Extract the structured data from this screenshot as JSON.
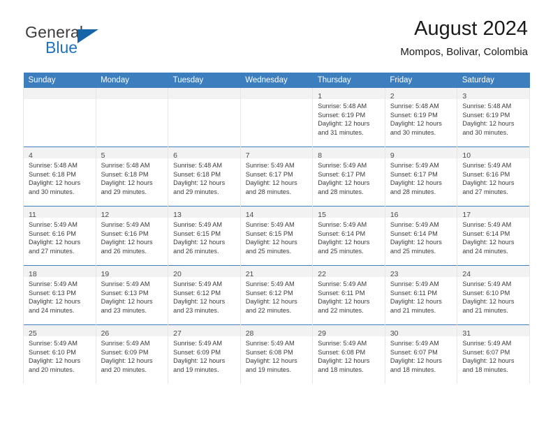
{
  "brand": {
    "name_part1": "General",
    "name_part2": "Blue"
  },
  "header": {
    "title": "August 2024",
    "subtitle": "Mompos, Bolivar, Colombia"
  },
  "colors": {
    "header_blue": "#3d7ebe",
    "logo_blue": "#1e73be",
    "daynum_band": "#f2f2f2",
    "cell_border": "#e6e6e6"
  },
  "weekdays": [
    "Sunday",
    "Monday",
    "Tuesday",
    "Wednesday",
    "Thursday",
    "Friday",
    "Saturday"
  ],
  "weeks": [
    [
      {
        "day": "",
        "lines": []
      },
      {
        "day": "",
        "lines": []
      },
      {
        "day": "",
        "lines": []
      },
      {
        "day": "",
        "lines": []
      },
      {
        "day": "1",
        "lines": [
          "Sunrise: 5:48 AM",
          "Sunset: 6:19 PM",
          "Daylight: 12 hours",
          "and 31 minutes."
        ]
      },
      {
        "day": "2",
        "lines": [
          "Sunrise: 5:48 AM",
          "Sunset: 6:19 PM",
          "Daylight: 12 hours",
          "and 30 minutes."
        ]
      },
      {
        "day": "3",
        "lines": [
          "Sunrise: 5:48 AM",
          "Sunset: 6:19 PM",
          "Daylight: 12 hours",
          "and 30 minutes."
        ]
      }
    ],
    [
      {
        "day": "4",
        "lines": [
          "Sunrise: 5:48 AM",
          "Sunset: 6:18 PM",
          "Daylight: 12 hours",
          "and 30 minutes."
        ]
      },
      {
        "day": "5",
        "lines": [
          "Sunrise: 5:48 AM",
          "Sunset: 6:18 PM",
          "Daylight: 12 hours",
          "and 29 minutes."
        ]
      },
      {
        "day": "6",
        "lines": [
          "Sunrise: 5:48 AM",
          "Sunset: 6:18 PM",
          "Daylight: 12 hours",
          "and 29 minutes."
        ]
      },
      {
        "day": "7",
        "lines": [
          "Sunrise: 5:49 AM",
          "Sunset: 6:17 PM",
          "Daylight: 12 hours",
          "and 28 minutes."
        ]
      },
      {
        "day": "8",
        "lines": [
          "Sunrise: 5:49 AM",
          "Sunset: 6:17 PM",
          "Daylight: 12 hours",
          "and 28 minutes."
        ]
      },
      {
        "day": "9",
        "lines": [
          "Sunrise: 5:49 AM",
          "Sunset: 6:17 PM",
          "Daylight: 12 hours",
          "and 28 minutes."
        ]
      },
      {
        "day": "10",
        "lines": [
          "Sunrise: 5:49 AM",
          "Sunset: 6:16 PM",
          "Daylight: 12 hours",
          "and 27 minutes."
        ]
      }
    ],
    [
      {
        "day": "11",
        "lines": [
          "Sunrise: 5:49 AM",
          "Sunset: 6:16 PM",
          "Daylight: 12 hours",
          "and 27 minutes."
        ]
      },
      {
        "day": "12",
        "lines": [
          "Sunrise: 5:49 AM",
          "Sunset: 6:16 PM",
          "Daylight: 12 hours",
          "and 26 minutes."
        ]
      },
      {
        "day": "13",
        "lines": [
          "Sunrise: 5:49 AM",
          "Sunset: 6:15 PM",
          "Daylight: 12 hours",
          "and 26 minutes."
        ]
      },
      {
        "day": "14",
        "lines": [
          "Sunrise: 5:49 AM",
          "Sunset: 6:15 PM",
          "Daylight: 12 hours",
          "and 25 minutes."
        ]
      },
      {
        "day": "15",
        "lines": [
          "Sunrise: 5:49 AM",
          "Sunset: 6:14 PM",
          "Daylight: 12 hours",
          "and 25 minutes."
        ]
      },
      {
        "day": "16",
        "lines": [
          "Sunrise: 5:49 AM",
          "Sunset: 6:14 PM",
          "Daylight: 12 hours",
          "and 25 minutes."
        ]
      },
      {
        "day": "17",
        "lines": [
          "Sunrise: 5:49 AM",
          "Sunset: 6:14 PM",
          "Daylight: 12 hours",
          "and 24 minutes."
        ]
      }
    ],
    [
      {
        "day": "18",
        "lines": [
          "Sunrise: 5:49 AM",
          "Sunset: 6:13 PM",
          "Daylight: 12 hours",
          "and 24 minutes."
        ]
      },
      {
        "day": "19",
        "lines": [
          "Sunrise: 5:49 AM",
          "Sunset: 6:13 PM",
          "Daylight: 12 hours",
          "and 23 minutes."
        ]
      },
      {
        "day": "20",
        "lines": [
          "Sunrise: 5:49 AM",
          "Sunset: 6:12 PM",
          "Daylight: 12 hours",
          "and 23 minutes."
        ]
      },
      {
        "day": "21",
        "lines": [
          "Sunrise: 5:49 AM",
          "Sunset: 6:12 PM",
          "Daylight: 12 hours",
          "and 22 minutes."
        ]
      },
      {
        "day": "22",
        "lines": [
          "Sunrise: 5:49 AM",
          "Sunset: 6:11 PM",
          "Daylight: 12 hours",
          "and 22 minutes."
        ]
      },
      {
        "day": "23",
        "lines": [
          "Sunrise: 5:49 AM",
          "Sunset: 6:11 PM",
          "Daylight: 12 hours",
          "and 21 minutes."
        ]
      },
      {
        "day": "24",
        "lines": [
          "Sunrise: 5:49 AM",
          "Sunset: 6:10 PM",
          "Daylight: 12 hours",
          "and 21 minutes."
        ]
      }
    ],
    [
      {
        "day": "25",
        "lines": [
          "Sunrise: 5:49 AM",
          "Sunset: 6:10 PM",
          "Daylight: 12 hours",
          "and 20 minutes."
        ]
      },
      {
        "day": "26",
        "lines": [
          "Sunrise: 5:49 AM",
          "Sunset: 6:09 PM",
          "Daylight: 12 hours",
          "and 20 minutes."
        ]
      },
      {
        "day": "27",
        "lines": [
          "Sunrise: 5:49 AM",
          "Sunset: 6:09 PM",
          "Daylight: 12 hours",
          "and 19 minutes."
        ]
      },
      {
        "day": "28",
        "lines": [
          "Sunrise: 5:49 AM",
          "Sunset: 6:08 PM",
          "Daylight: 12 hours",
          "and 19 minutes."
        ]
      },
      {
        "day": "29",
        "lines": [
          "Sunrise: 5:49 AM",
          "Sunset: 6:08 PM",
          "Daylight: 12 hours",
          "and 18 minutes."
        ]
      },
      {
        "day": "30",
        "lines": [
          "Sunrise: 5:49 AM",
          "Sunset: 6:07 PM",
          "Daylight: 12 hours",
          "and 18 minutes."
        ]
      },
      {
        "day": "31",
        "lines": [
          "Sunrise: 5:49 AM",
          "Sunset: 6:07 PM",
          "Daylight: 12 hours",
          "and 18 minutes."
        ]
      }
    ]
  ]
}
